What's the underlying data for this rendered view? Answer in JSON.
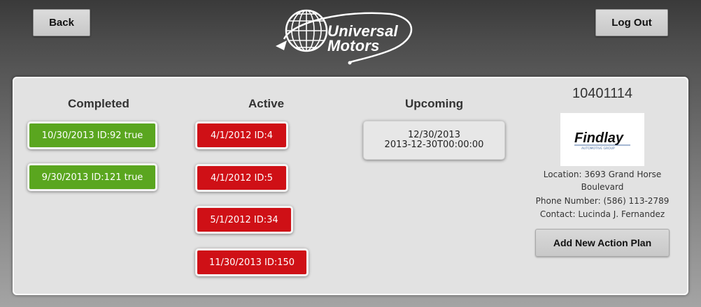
{
  "header": {
    "back_label": "Back",
    "logout_label": "Log Out",
    "logo_line1": "Universal",
    "logo_line2": "Motors"
  },
  "columns": {
    "completed": {
      "title": "Completed",
      "items": [
        "10/30/2013 ID:92 true",
        "9/30/2013 ID:121 true"
      ]
    },
    "active": {
      "title": "Active",
      "items": [
        "4/1/2012 ID:4",
        "4/1/2012 ID:5",
        "5/1/2012 ID:34",
        "11/30/2013 ID:150"
      ]
    },
    "upcoming": {
      "title": "Upcoming",
      "items": [
        {
          "line1": "12/30/2013",
          "line2": "2013-12-30T00:00:00"
        }
      ]
    }
  },
  "dealer": {
    "account_id": "10401114",
    "logo_name": "Findlay",
    "logo_sub": "AUTOMOTIVE GROUP",
    "location": "Location: 3693 Grand Horse Boulevard",
    "phone": "Phone Number: (586) 113-2789",
    "contact": "Contact: Lucinda J. Fernandez",
    "add_button": "Add New Action Plan"
  },
  "colors": {
    "completed": "#5aa61f",
    "active": "#cf1016",
    "upcoming": "#e7e7e7",
    "panel": "#e2e2e2"
  }
}
